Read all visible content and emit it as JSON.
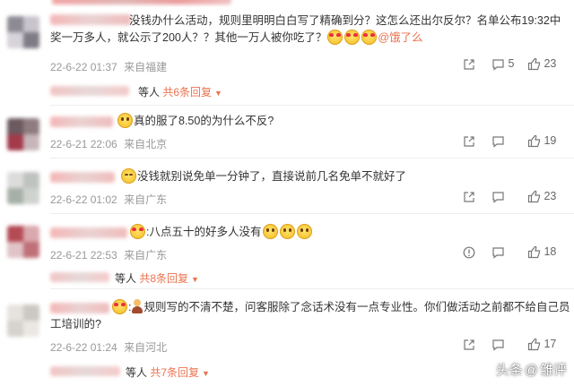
{
  "colors": {
    "accent": "#eb7350",
    "meta": "#999999",
    "text": "#333333"
  },
  "comments": [
    {
      "text_line1": "没钱办什么活动，规则里明明白白写了精确到分？这怎么还出尔反尔？名单公布19:32中",
      "text_line2_a": "奖一万多人，就公示了200人？？其他一万人被你吃了？",
      "mention": "@饿了么",
      "date": "22-6-22 01:37",
      "location": "来自福建",
      "comment_count": "5",
      "like_count": "23",
      "reply_suffix": "等人",
      "reply_more": "共6条回复",
      "reply_arrow": "▼"
    },
    {
      "text": "真的服了8.50的为什么不反?",
      "date": "22-6-21 22:06",
      "location": "来自北京",
      "like_count": "19"
    },
    {
      "text": "没钱就别说免单一分钟了，直接说前几名免单不就好了",
      "date": "22-6-22 01:02",
      "location": "来自广东",
      "like_count": "23"
    },
    {
      "text": "八点五十的好多人没有",
      "date": "22-6-21 22:53",
      "location": "来自广东",
      "like_count": "18",
      "reply_suffix": "等人",
      "reply_more": "共8条回复",
      "reply_arrow": "▼"
    },
    {
      "text_line1": "规则写的不清不楚，问客服除了念话术没有一点专业性。你们做活动之前都不给自己员",
      "text_line2": "工培训的?",
      "date": "22-6-22 01:24",
      "location": "来自河北",
      "like_count": "17",
      "reply_suffix": "等人",
      "reply_more": "共7条回复",
      "reply_arrow": "▼"
    }
  ],
  "watermark": {
    "source": "头条",
    "sep": "@",
    "author": "雏评"
  }
}
